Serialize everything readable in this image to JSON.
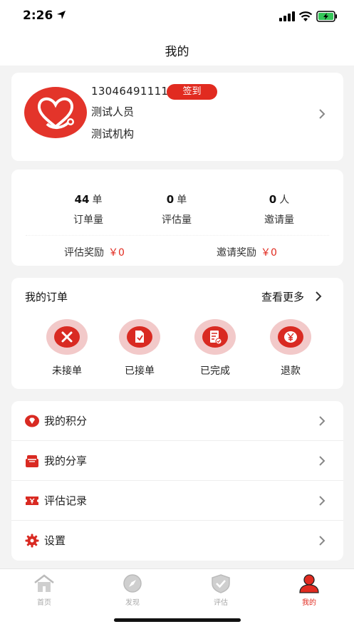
{
  "status_bar": {
    "time": "2:26"
  },
  "nav": {
    "title": "我的"
  },
  "profile": {
    "phone": "13046491111",
    "checkin_label": "签到",
    "name": "测试人员",
    "org": "测试机构"
  },
  "stats": {
    "items": [
      {
        "value": "44",
        "unit": "单",
        "label": "订单量"
      },
      {
        "value": "0",
        "unit": "单",
        "label": "评估量"
      },
      {
        "value": "0",
        "unit": "人",
        "label": "邀请量"
      }
    ],
    "rewards": [
      {
        "label": "评估奖励",
        "value": "￥0"
      },
      {
        "label": "邀请奖励",
        "value": "￥0"
      }
    ]
  },
  "orders": {
    "title": "我的订单",
    "more_label": "查看更多",
    "items": [
      {
        "label": "未接单",
        "icon": "x-icon"
      },
      {
        "label": "已接单",
        "icon": "document-icon"
      },
      {
        "label": "已完成",
        "icon": "checklist-icon"
      },
      {
        "label": "退款",
        "icon": "yen-icon"
      }
    ]
  },
  "menu": {
    "items": [
      {
        "label": "我的积分",
        "icon": "diamond-icon"
      },
      {
        "label": "我的分享",
        "icon": "gift-icon"
      },
      {
        "label": "评估记录",
        "icon": "ticket-icon"
      },
      {
        "label": "设置",
        "icon": "gear-icon"
      }
    ]
  },
  "tabs": [
    {
      "label": "首页",
      "icon": "home-icon"
    },
    {
      "label": "发现",
      "icon": "compass-icon"
    },
    {
      "label": "评估",
      "icon": "shield-check-icon"
    },
    {
      "label": "我的",
      "icon": "user-icon",
      "active": true
    }
  ],
  "colors": {
    "accent": "#e12b20",
    "background": "#f3f3f3",
    "icon_halo": "#f2c9c9"
  }
}
